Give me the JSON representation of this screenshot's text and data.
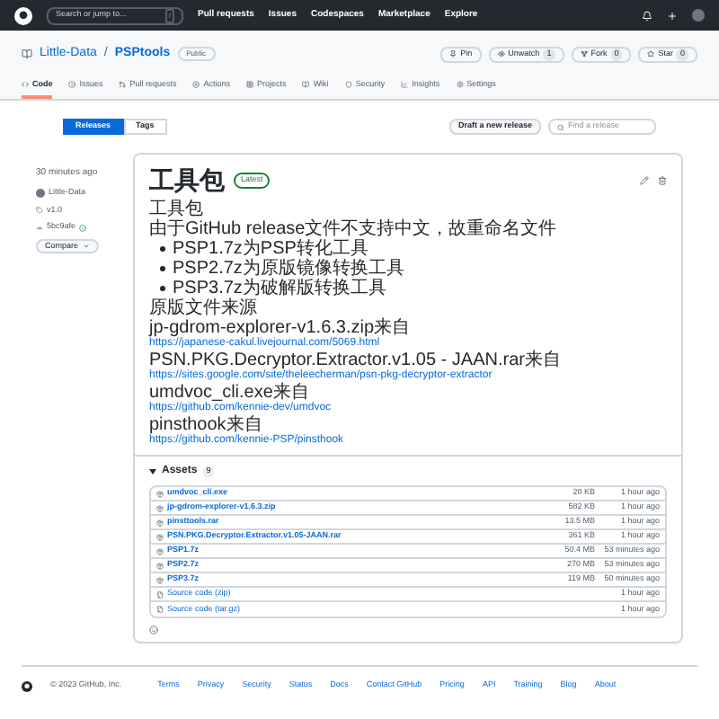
{
  "top_nav": {
    "search_placeholder": "Search or jump to...",
    "search_key": "/",
    "links": [
      "Pull requests",
      "Issues",
      "Codespaces",
      "Marketplace",
      "Explore"
    ]
  },
  "repo": {
    "owner": "Little-Data",
    "separator": "/",
    "name": "PSPtools",
    "visibility": "Public",
    "actions": [
      {
        "kind": "pin",
        "label": "Pin"
      },
      {
        "kind": "watch",
        "label": "Unwatch",
        "count": "1"
      },
      {
        "kind": "fork",
        "label": "Fork",
        "count": "0"
      },
      {
        "kind": "star",
        "label": "Star",
        "count": "0"
      }
    ]
  },
  "tabs": [
    {
      "kind": "code",
      "label": "Code",
      "selected": true
    },
    {
      "kind": "issues",
      "label": "Issues",
      "selected": false
    },
    {
      "kind": "pulls",
      "label": "Pull requests",
      "selected": false
    },
    {
      "kind": "actions",
      "label": "Actions",
      "selected": false
    },
    {
      "kind": "projects",
      "label": "Projects",
      "selected": false
    },
    {
      "kind": "wiki",
      "label": "Wiki",
      "selected": false
    },
    {
      "kind": "security",
      "label": "Security",
      "selected": false
    },
    {
      "kind": "insights",
      "label": "Insights",
      "selected": false
    },
    {
      "kind": "settings",
      "label": "Settings",
      "selected": false
    }
  ],
  "release_tabs": [
    {
      "label": "Releases",
      "selected": true
    },
    {
      "label": "Tags",
      "selected": false
    }
  ],
  "draft_button": "Draft a new release",
  "find_placeholder": "Find a release",
  "sidebar": {
    "time": "30 minutes ago",
    "author": "Little-Data",
    "tag": "v1.0",
    "commit": "5bc9afe",
    "compare": "Compare"
  },
  "release": {
    "title": "工具包",
    "badge": "Latest",
    "body": [
      {
        "kind": "p",
        "text": "工具包"
      },
      {
        "kind": "p",
        "text": "由于GitHub release文件不支持中文，故重命名文件"
      },
      {
        "kind": "li",
        "text": "PSP1.7z为PSP转化工具"
      },
      {
        "kind": "li",
        "text": "PSP2.7z为原版镜像转换工具"
      },
      {
        "kind": "li",
        "text": "PSP3.7z为破解版转换工具"
      },
      {
        "kind": "p",
        "text": "原版文件来源"
      },
      {
        "kind": "link",
        "text": "jp-gdrom-explorer-v1.6.3.zip来自",
        "url": "https://japanese-cakul.livejournal.com/5069.html"
      },
      {
        "kind": "link",
        "text": "PSN.PKG.Decryptor.Extractor.v1.05 - JAAN.rar来自",
        "url": "https://sites.google.com/site/theleecherman/psn-pkg-decryptor-extractor"
      },
      {
        "kind": "link",
        "text": "umdvoc_cli.exe来自",
        "url": "https://github.com/kennie-dev/umdvoc"
      },
      {
        "kind": "link",
        "text": "pinsthook来自",
        "url": "https://github.com/kennie-PSP/pinsthook"
      }
    ]
  },
  "assets": {
    "title": "Assets",
    "count": "9",
    "items": [
      {
        "kind": "file",
        "name": "umdvoc_cli.exe",
        "size": "20 KB",
        "time": "1 hour ago"
      },
      {
        "kind": "file",
        "name": "jp-gdrom-explorer-v1.6.3.zip",
        "size": "582 KB",
        "time": "1 hour ago"
      },
      {
        "kind": "file",
        "name": "pinsttools.rar",
        "size": "13.5 MB",
        "time": "1 hour ago"
      },
      {
        "kind": "file",
        "name": "PSN.PKG.Decryptor.Extractor.v1.05-JAAN.rar",
        "size": "361 KB",
        "time": "1 hour ago"
      },
      {
        "kind": "file",
        "name": "PSP1.7z",
        "size": "50.4 MB",
        "time": "53 minutes ago"
      },
      {
        "kind": "file",
        "name": "PSP2.7z",
        "size": "270 MB",
        "time": "53 minutes ago"
      },
      {
        "kind": "file",
        "name": "PSP3.7z",
        "size": "119 MB",
        "time": "50 minutes ago"
      },
      {
        "kind": "source",
        "name": "Source code (zip)",
        "time": "1 hour ago"
      },
      {
        "kind": "source",
        "name": "Source code (tar.gz)",
        "time": "1 hour ago"
      }
    ]
  },
  "footer": {
    "copyright": "© 2023 GitHub, Inc.",
    "links": [
      "Terms",
      "Privacy",
      "Security",
      "Status",
      "Docs",
      "Contact GitHub",
      "Pricing",
      "API",
      "Training",
      "Blog",
      "About"
    ]
  }
}
